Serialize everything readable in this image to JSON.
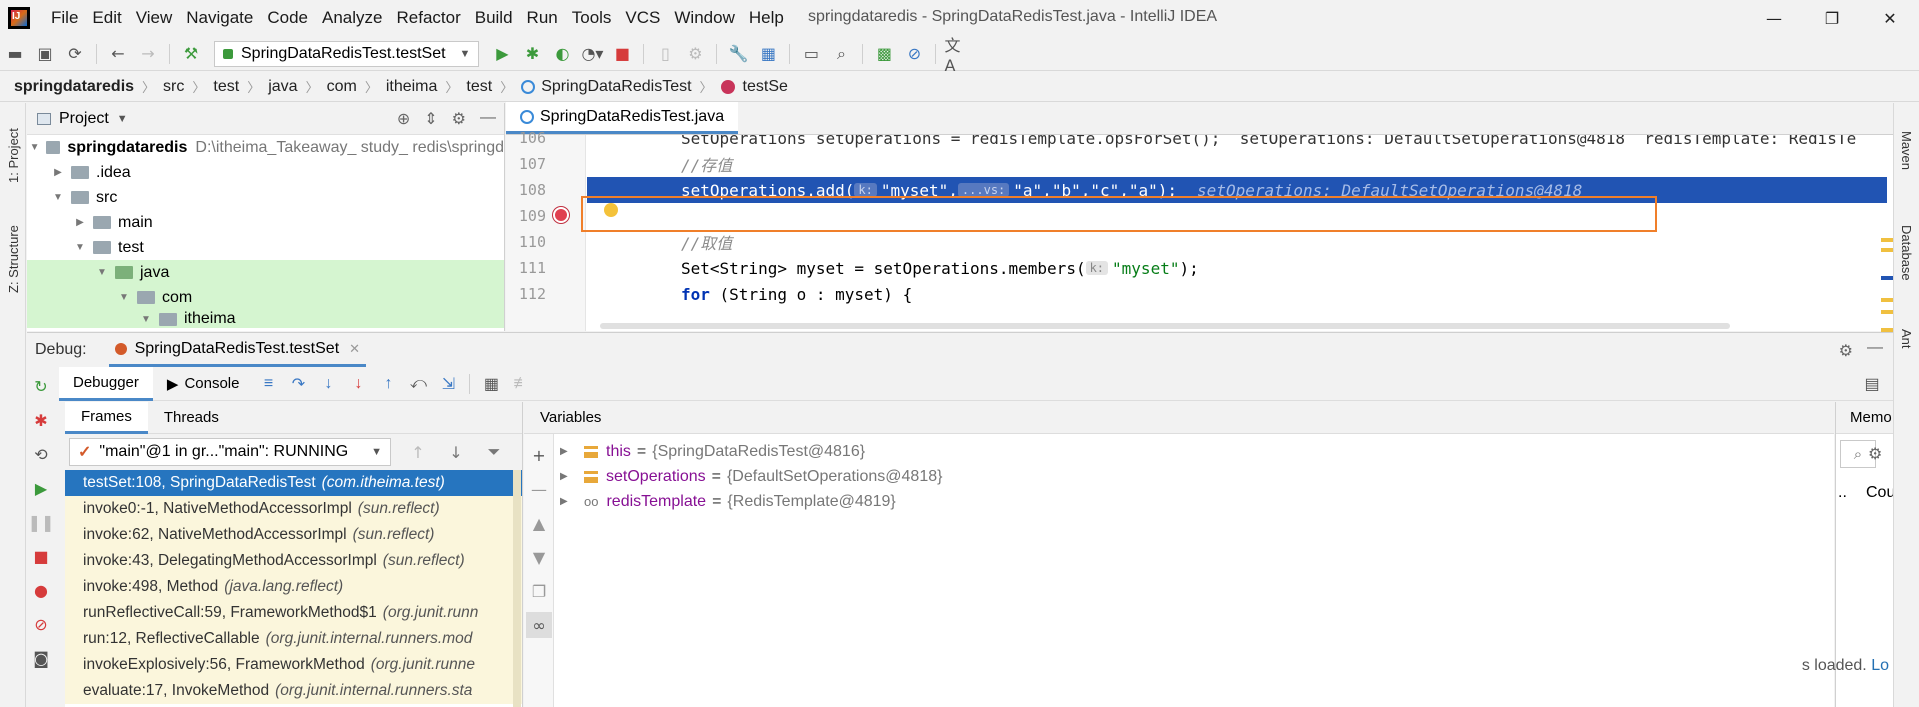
{
  "window": {
    "title": "springdataredis - SpringDataRedisTest.java - IntelliJ IDEA",
    "menu": [
      "File",
      "Edit",
      "View",
      "Navigate",
      "Code",
      "Analyze",
      "Refactor",
      "Build",
      "Run",
      "Tools",
      "VCS",
      "Window",
      "Help"
    ],
    "controls": {
      "minimize": "—",
      "maximize": "❐",
      "close": "✕"
    }
  },
  "toolbar": {
    "run_config": "SpringDataRedisTest.testSet"
  },
  "breadcrumb": [
    "springdataredis",
    "src",
    "test",
    "java",
    "com",
    "itheima",
    "test",
    "SpringDataRedisTest",
    "testSe"
  ],
  "left_stripe": {
    "project_tab": "1: Project",
    "structure_tab": "Z: Structure"
  },
  "right_stripe": {
    "maven_tab": "Maven",
    "database_tab": "Database",
    "ant_tab": "Ant"
  },
  "project": {
    "title": "Project",
    "tree": [
      {
        "label": "springdataredis",
        "path": "D:\\itheima_Takeaway_ study_ redis\\springd",
        "arrow": "▼"
      },
      {
        "label": ".idea",
        "arrow": "▶"
      },
      {
        "label": "src",
        "arrow": "▼"
      },
      {
        "label": "main",
        "arrow": "▶"
      },
      {
        "label": "test",
        "arrow": "▼"
      },
      {
        "label": "java",
        "arrow": "▼"
      },
      {
        "label": "com",
        "arrow": "▼"
      },
      {
        "label": "itheima",
        "arrow": "▼"
      }
    ]
  },
  "editor": {
    "tab": "SpringDataRedisTest.java",
    "lines": [
      {
        "num": "106",
        "text": "SetOperations setOperations = redisTemplate.opsForSet();  setOperations: DefaultSetOperations@4818  redisTemplate: RedisTe"
      },
      {
        "num": "107",
        "text": "//存值"
      },
      {
        "num": "108",
        "pre": "setOperations.add(",
        "hint1": "k:",
        "str1": "\"myset\"",
        "mid": ",",
        "hint2": "...vs:",
        "strs": "\"a\",\"b\",\"c\",\"a\"",
        "post": ");",
        "inline": "setOperations: DefaultSetOperations@4818"
      },
      {
        "num": "109",
        "text": ""
      },
      {
        "num": "110",
        "text": "//取值"
      },
      {
        "num": "111",
        "pre": "Set<String> myset = setOperations.members(",
        "hint": "k:",
        "str": "\"myset\"",
        "post": ");"
      },
      {
        "num": "112",
        "kw": "for",
        "post": " (String o : myset) {"
      }
    ]
  },
  "debug": {
    "label": "Debug:",
    "session": "SpringDataRedisTest.testSet",
    "tabs": {
      "debugger": "Debugger",
      "console": "Console"
    },
    "subtabs": {
      "frames": "Frames",
      "threads": "Threads"
    },
    "thread": "\"main\"@1 in gr...\"main\": RUNNING",
    "frames": [
      {
        "method": "testSet:108, SpringDataRedisTest",
        "pkg": "(com.itheima.test)"
      },
      {
        "method": "invoke0:-1, NativeMethodAccessorImpl",
        "pkg": "(sun.reflect)"
      },
      {
        "method": "invoke:62, NativeMethodAccessorImpl",
        "pkg": "(sun.reflect)"
      },
      {
        "method": "invoke:43, DelegatingMethodAccessorImpl",
        "pkg": "(sun.reflect)"
      },
      {
        "method": "invoke:498, Method",
        "pkg": "(java.lang.reflect)"
      },
      {
        "method": "runReflectiveCall:59, FrameworkMethod$1",
        "pkg": "(org.junit.runn"
      },
      {
        "method": "run:12, ReflectiveCallable",
        "pkg": "(org.junit.internal.runners.mod"
      },
      {
        "method": "invokeExplosively:56, FrameworkMethod",
        "pkg": "(org.junit.runne"
      },
      {
        "method": "evaluate:17, InvokeMethod",
        "pkg": "(org.junit.internal.runners.sta"
      }
    ],
    "variables_title": "Variables",
    "variables": [
      {
        "name": "this",
        "value": "{SpringDataRedisTest@4816}"
      },
      {
        "name": "setOperations",
        "value": "{DefaultSetOperations@4818}"
      },
      {
        "name": "redisTemplate",
        "value": "{RedisTemplate@4819}"
      }
    ],
    "memory": {
      "title": "Memo",
      "dots": "..",
      "count": "Count",
      "status": "s loaded.",
      "link": "Lo"
    }
  }
}
